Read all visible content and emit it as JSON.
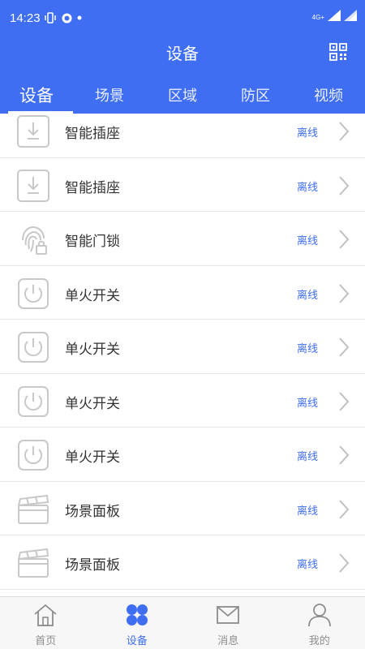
{
  "status_bar": {
    "time": "14:23",
    "network": "4G+"
  },
  "header": {
    "title": "设备"
  },
  "tabs": [
    {
      "label": "设备",
      "active": true
    },
    {
      "label": "场景",
      "active": false
    },
    {
      "label": "区域",
      "active": false
    },
    {
      "label": "防区",
      "active": false
    },
    {
      "label": "视频",
      "active": false
    }
  ],
  "devices": [
    {
      "name": "智能插座",
      "status": "离线",
      "icon": "socket-icon"
    },
    {
      "name": "智能插座",
      "status": "离线",
      "icon": "socket-icon"
    },
    {
      "name": "智能门锁",
      "status": "离线",
      "icon": "fingerprint-lock-icon"
    },
    {
      "name": "单火开关",
      "status": "离线",
      "icon": "power-switch-icon"
    },
    {
      "name": "单火开关",
      "status": "离线",
      "icon": "power-switch-icon"
    },
    {
      "name": "单火开关",
      "status": "离线",
      "icon": "power-switch-icon"
    },
    {
      "name": "单火开关",
      "status": "离线",
      "icon": "power-switch-icon"
    },
    {
      "name": "场景面板",
      "status": "离线",
      "icon": "scene-panel-icon"
    },
    {
      "name": "场景面板",
      "status": "离线",
      "icon": "scene-panel-icon"
    }
  ],
  "tabbar": [
    {
      "label": "首页",
      "icon": "home-icon",
      "active": false
    },
    {
      "label": "设备",
      "icon": "device-grid-icon",
      "active": true
    },
    {
      "label": "消息",
      "icon": "mail-icon",
      "active": false
    },
    {
      "label": "我的",
      "icon": "user-icon",
      "active": false
    }
  ],
  "colors": {
    "primary": "#3f6ef3",
    "offline_text": "#3f6ef3",
    "icon_gray": "#c8c8c8"
  }
}
